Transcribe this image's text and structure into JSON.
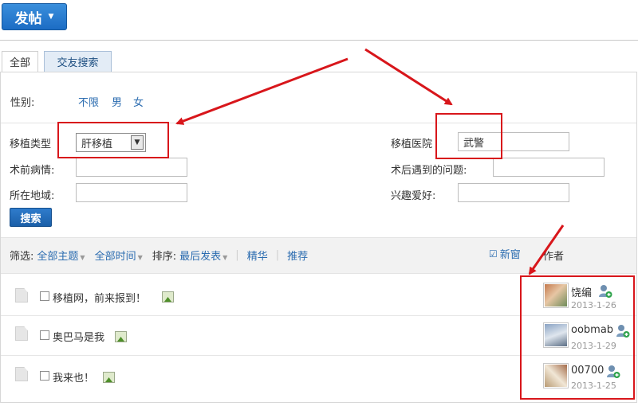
{
  "post_button": {
    "label": "发帖"
  },
  "tabs": [
    {
      "label": "全部"
    },
    {
      "label": "交友搜索"
    }
  ],
  "gender": {
    "label": "性别:",
    "options": [
      "不限",
      "男",
      "女"
    ]
  },
  "form": {
    "transplant_type": {
      "label": "移植类型",
      "value": "肝移植"
    },
    "hospital": {
      "label": "移植医院",
      "value": "武警"
    },
    "pre_condition": {
      "label": "术前病情:",
      "value": ""
    },
    "post_problems": {
      "label": "术后遇到的问题:",
      "value": ""
    },
    "region": {
      "label": "所在地域:",
      "value": ""
    },
    "hobbies": {
      "label": "兴趣爱好:",
      "value": ""
    },
    "search_label": "搜索"
  },
  "filter_bar": {
    "filter_label": "筛选:",
    "all_topics": "全部主题",
    "all_time": "全部时间",
    "sort_label": "排序:",
    "last_post": "最后发表",
    "featured": "精华",
    "recommended": "推荐",
    "new_window": "新窗",
    "new_window_checked": true,
    "author_header": "作者"
  },
  "threads": [
    {
      "title": "移植网，前来报到！",
      "author": "饶编",
      "date": "2013-1-26"
    },
    {
      "title": "奥巴马是我",
      "author": "oobmab",
      "date": "2013-1-29"
    },
    {
      "title": "我来也！",
      "author": "00700",
      "date": "2013-1-25"
    }
  ],
  "colors": {
    "accent": "#1c6cc4",
    "link": "#2b6cb0",
    "annotation_red": "#d8161b"
  }
}
